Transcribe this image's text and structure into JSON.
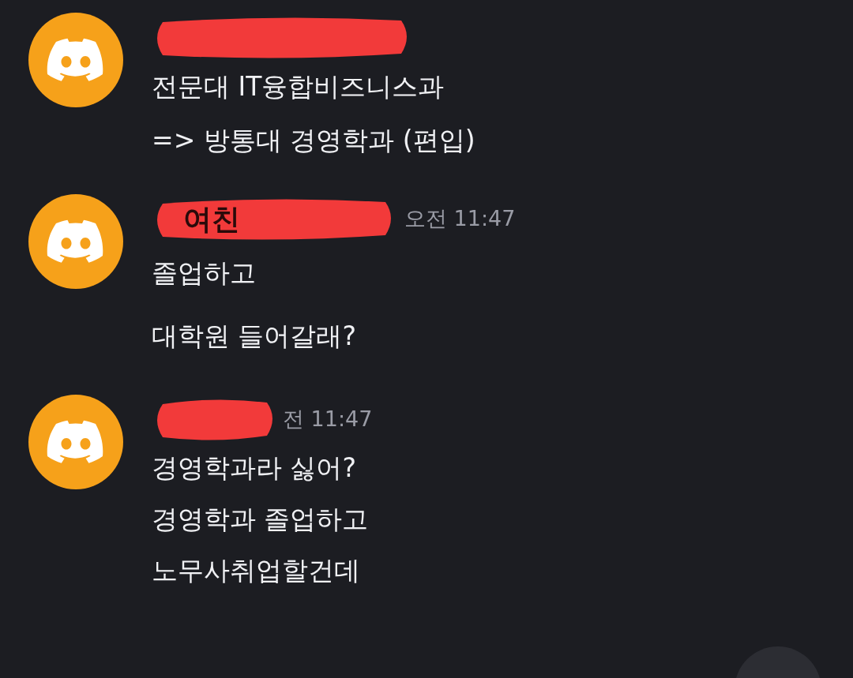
{
  "messages": [
    {
      "author": {
        "redacted": true
      },
      "lines": [
        "전문대 IT융합비즈니스과",
        "=> 방통대 경영학과 (편입)"
      ]
    },
    {
      "author": {
        "redacted": true,
        "visible_text": "여친"
      },
      "time": "오전 11:47",
      "lines": [
        "졸업하고",
        "대학원 들어갈래?"
      ]
    },
    {
      "author": {
        "redacted": true
      },
      "time": "전 11:47",
      "lines": [
        "경영학과라 싫어?",
        "경영학과 졸업하고",
        "노무사취업할건데"
      ]
    }
  ]
}
